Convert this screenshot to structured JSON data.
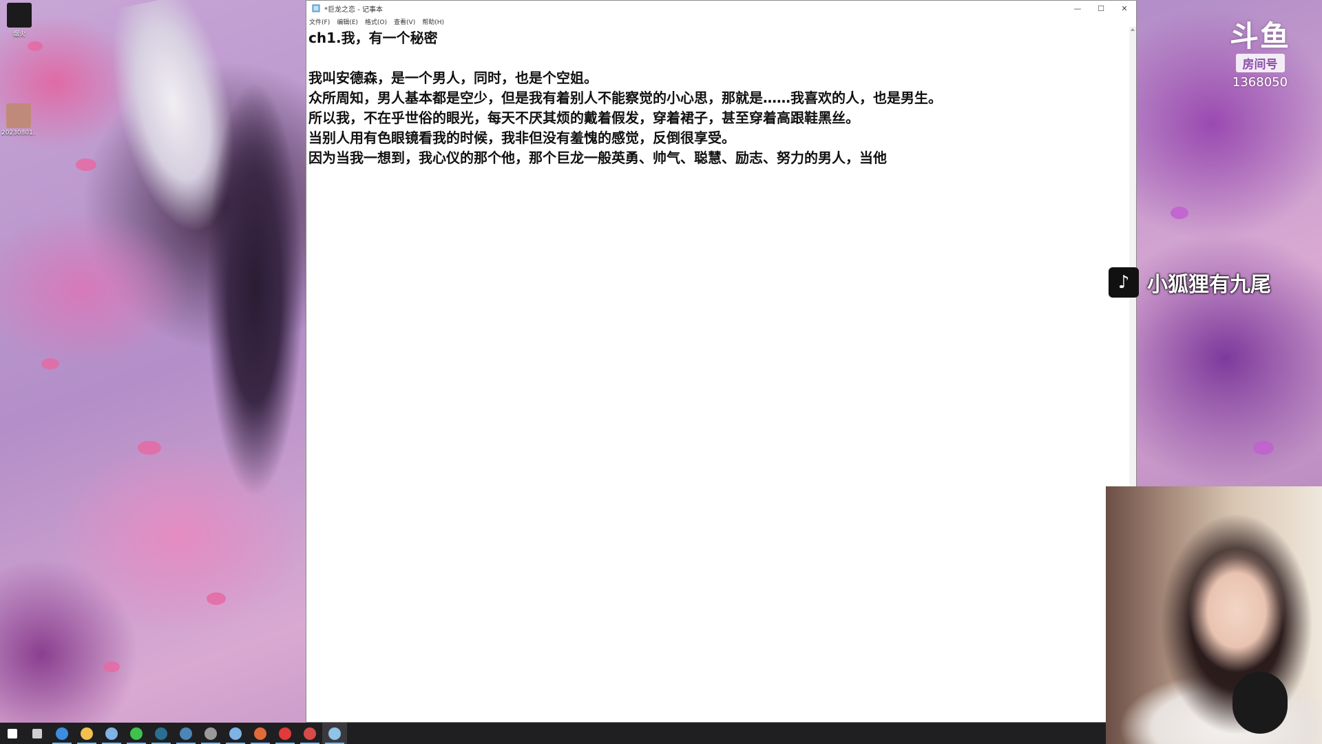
{
  "desktop": {
    "icons": [
      {
        "label": "烟火",
        "icon": "app-shortcut-icon",
        "color": "#1b1b1b"
      },
      {
        "label": "20230801...",
        "icon": "photo-file-icon",
        "color": "#c08a7a"
      }
    ]
  },
  "notepad": {
    "title": "*巨龙之恋 - 记事本",
    "menu": [
      "文件(F)",
      "编辑(E)",
      "格式(O)",
      "查看(V)",
      "帮助(H)"
    ],
    "window_buttons": {
      "minimize": "—",
      "maximize": "☐",
      "close": "✕"
    },
    "lines": [
      "ch1.我，有一个秘密",
      "",
      "我叫安德森，是一个男人，同时，也是个空姐。",
      "众所周知，男人基本都是空少，但是我有着别人不能察觉的小心思，那就是……我喜欢的人，也是男生。",
      "所以我，不在乎世俗的眼光，每天不厌其烦的戴着假发，穿着裙子，甚至穿着高跟鞋黑丝。",
      "当别人用有色眼镜看我的时候，我非但没有羞愧的感觉，反倒很享受。",
      "因为当我一想到，我心仪的那个他，那个巨龙一般英勇、帅气、聪慧、励志、努力的男人，当他"
    ]
  },
  "overlay": {
    "douyu_brand": "斗鱼",
    "room_label": "房间号",
    "room_number": "1368050",
    "tiktok_icon": "♪",
    "tiktok_name": "小狐狸有九尾"
  },
  "taskbar": {
    "items": [
      {
        "name": "start-icon",
        "color": "#ffffff"
      },
      {
        "name": "task-view-icon",
        "color": "#cfcfcf"
      },
      {
        "name": "app-blue-circle-icon",
        "color": "#3c8de0"
      },
      {
        "name": "file-explorer-icon",
        "color": "#f2c14e"
      },
      {
        "name": "browser-icon",
        "color": "#7fb2e5"
      },
      {
        "name": "wechat-icon",
        "color": "#3ec24a"
      },
      {
        "name": "monitor-app-icon",
        "color": "#2a6f8f"
      },
      {
        "name": "steam-icon",
        "color": "#4b86b4"
      },
      {
        "name": "obs-icon",
        "color": "#9a9a9a"
      },
      {
        "name": "browser-2-icon",
        "color": "#7fb2e5"
      },
      {
        "name": "game-app-icon",
        "color": "#e06a3a"
      },
      {
        "name": "netease-music-icon",
        "color": "#e23a3a"
      },
      {
        "name": "red-app-icon",
        "color": "#d84a4a"
      },
      {
        "name": "notepad-icon",
        "color": "#8fc3e8"
      }
    ]
  }
}
